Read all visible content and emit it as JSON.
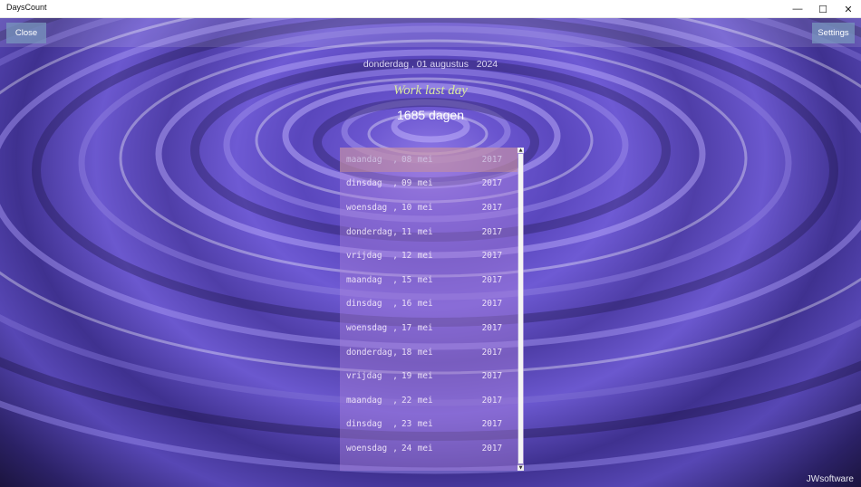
{
  "window": {
    "title": "DaysCount",
    "minimize_glyph": "—",
    "maximize_glyph": "☐",
    "close_glyph": "✕"
  },
  "toolbar": {
    "close_label": "Close",
    "settings_label": "Settings"
  },
  "header": {
    "date": "donderdag , 01 augustus   2024",
    "subtitle": "Work last day",
    "count": "1685 dagen"
  },
  "list": {
    "items": [
      {
        "day": "maandag",
        "comma": ",",
        "dd": "08",
        "month": "mei",
        "year": "2017"
      },
      {
        "day": "dinsdag",
        "comma": ",",
        "dd": "09",
        "month": "mei",
        "year": "2017"
      },
      {
        "day": "woensdag",
        "comma": ",",
        "dd": "10",
        "month": "mei",
        "year": "2017"
      },
      {
        "day": "donderdag",
        "comma": ",",
        "dd": "11",
        "month": "mei",
        "year": "2017"
      },
      {
        "day": "vrijdag",
        "comma": ",",
        "dd": "12",
        "month": "mei",
        "year": "2017"
      },
      {
        "day": "maandag",
        "comma": ",",
        "dd": "15",
        "month": "mei",
        "year": "2017"
      },
      {
        "day": "dinsdag",
        "comma": ",",
        "dd": "16",
        "month": "mei",
        "year": "2017"
      },
      {
        "day": "woensdag",
        "comma": ",",
        "dd": "17",
        "month": "mei",
        "year": "2017"
      },
      {
        "day": "donderdag",
        "comma": ",",
        "dd": "18",
        "month": "mei",
        "year": "2017"
      },
      {
        "day": "vrijdag",
        "comma": ",",
        "dd": "19",
        "month": "mei",
        "year": "2017"
      },
      {
        "day": "maandag",
        "comma": ",",
        "dd": "22",
        "month": "mei",
        "year": "2017"
      },
      {
        "day": "dinsdag",
        "comma": ",",
        "dd": "23",
        "month": "mei",
        "year": "2017"
      },
      {
        "day": "woensdag",
        "comma": ",",
        "dd": "24",
        "month": "mei",
        "year": "2017"
      }
    ],
    "selected_index": 0
  },
  "footer": {
    "brand": "JWsoftware"
  },
  "colors": {
    "accent_button": "#7896be",
    "subtitle": "#d9e8a0"
  }
}
